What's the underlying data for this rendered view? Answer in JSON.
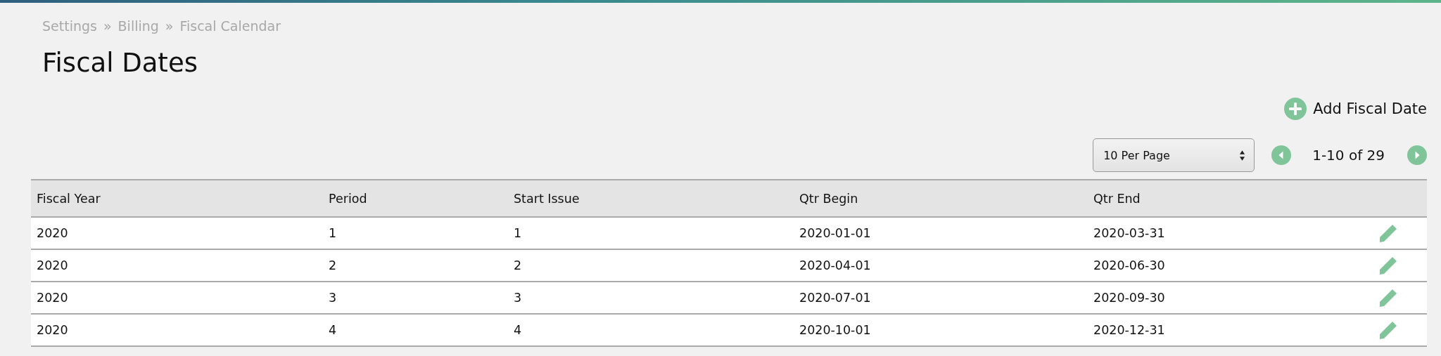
{
  "breadcrumb": [
    "Settings",
    "Billing",
    "Fiscal Calendar"
  ],
  "breadcrumb_separator": "»",
  "title": "Fiscal Dates",
  "add_button": {
    "label": "Add Fiscal Date"
  },
  "per_page": {
    "value": "10 Per Page"
  },
  "pagination": {
    "range": "1-10 of 29"
  },
  "table": {
    "columns": [
      "Fiscal Year",
      "Period",
      "Start Issue",
      "Qtr Begin",
      "Qtr End"
    ],
    "rows": [
      {
        "cells": [
          "2020",
          "1",
          "1",
          "2020-01-01",
          "2020-03-31"
        ]
      },
      {
        "cells": [
          "2020",
          "2",
          "2",
          "2020-04-01",
          "2020-06-30"
        ]
      },
      {
        "cells": [
          "2020",
          "3",
          "3",
          "2020-07-01",
          "2020-09-30"
        ]
      },
      {
        "cells": [
          "2020",
          "4",
          "4",
          "2020-10-01",
          "2020-12-31"
        ]
      }
    ]
  }
}
